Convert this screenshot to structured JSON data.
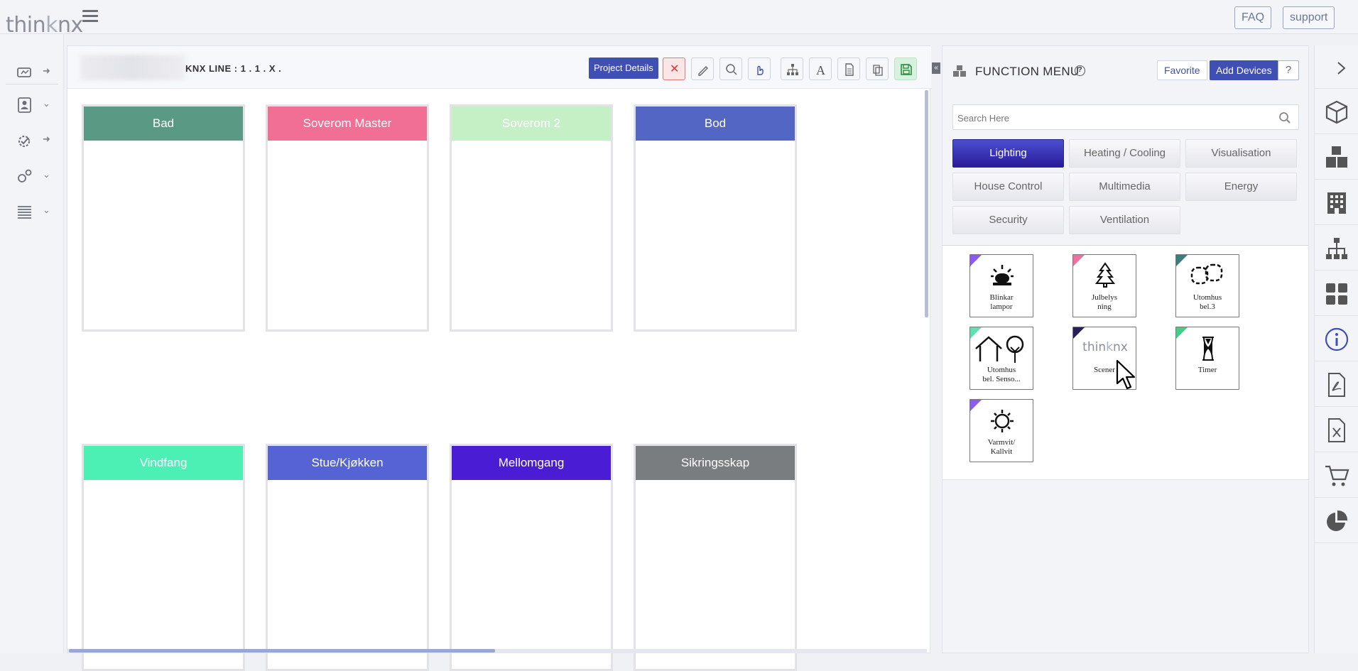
{
  "app": {
    "logo": "thinknx",
    "logo_accent": "k"
  },
  "header": {
    "faq_label": "FAQ",
    "support_label": "support"
  },
  "toolbar": {
    "knx_line": "KNX LINE : 1 . 1 . X .",
    "project_details_label": "Project Details"
  },
  "rooms": [
    {
      "name": "Bad",
      "color": "#5a9a84"
    },
    {
      "name": "Soverom Master",
      "color": "#f16e95"
    },
    {
      "name": "Soverom 2",
      "color": "#c5efc5"
    },
    {
      "name": "Bod",
      "color": "#5366c4"
    },
    {
      "name": "Vindfang",
      "color": "#4cf0b4"
    },
    {
      "name": "Stue/Kjøkken",
      "color": "#5563d4"
    },
    {
      "name": "Mellomgang",
      "color": "#4a1dd4"
    },
    {
      "name": "Sikringsskap",
      "color": "#7a7d80"
    }
  ],
  "function_menu": {
    "title": "FUNCTION MENU",
    "favorite_label": "Favorite",
    "add_devices_label": "Add Devices",
    "help_label": "?",
    "search_placeholder": "Search Here",
    "categories": [
      "Lighting",
      "Heating / Cooling",
      "Visualisation",
      "House Control",
      "Multimedia",
      "Energy",
      "Security",
      "Ventilation"
    ],
    "active_category": "Lighting",
    "devices": [
      {
        "label": "Blinkar\nlampor",
        "icon": "siren-icon",
        "corner": "#8a5cf0"
      },
      {
        "label": "Julbelys\nning",
        "icon": "christmas-tree-icon",
        "corner": "#f06fa0"
      },
      {
        "label": "Utomhus\nbel.3",
        "icon": "dashed-bulbs-icon",
        "corner": "#3a7f7a"
      },
      {
        "label": "Utomhus\nbel. Senso...",
        "icon": "house-tree-icon",
        "corner": "#5ee0b0"
      },
      {
        "label": "Scener",
        "icon": "thinknx-logo",
        "corner": "#2a1d5e"
      },
      {
        "label": "Timer",
        "icon": "hourglass-icon",
        "corner": "#3fcf8a"
      },
      {
        "label": "Varmvit/\nKallvit",
        "icon": "sun-icon",
        "corner": "#8a5cf0"
      }
    ]
  },
  "accent": "#3f4fb3"
}
